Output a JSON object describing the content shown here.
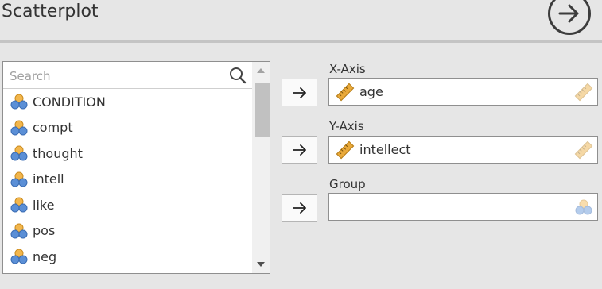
{
  "header": {
    "title": "Scatterplot"
  },
  "variables": {
    "search_placeholder": "Search",
    "items": [
      {
        "label": "CONDITION"
      },
      {
        "label": "compt"
      },
      {
        "label": "thought"
      },
      {
        "label": "intell"
      },
      {
        "label": "like"
      },
      {
        "label": "pos"
      },
      {
        "label": "neg"
      }
    ]
  },
  "targets": {
    "x_axis": {
      "label": "X-Axis",
      "value": "age"
    },
    "y_axis": {
      "label": "Y-Axis",
      "value": "intellect"
    },
    "group": {
      "label": "Group",
      "value": ""
    }
  },
  "colors": {
    "ruler": "#e9a93a",
    "nominal_circle_top": "#f2b64c",
    "nominal_circle_bottom": "#5b8fd6"
  }
}
